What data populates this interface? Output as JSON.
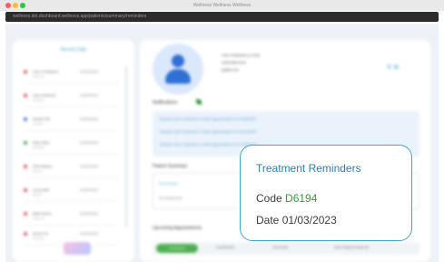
{
  "window": {
    "title": "Wellness Wellness Wellness",
    "url": "wellness.dot.dashboard.wellness.app/patients/summary/reminders",
    "traffic_colors": [
      "#ff5f57",
      "#febc2e",
      "#28c840"
    ]
  },
  "sidebar": {
    "title": "Recent Calls",
    "items": [
      {
        "name": "John Chambers",
        "sub": "Follow up",
        "date": "01/03/2023",
        "dot": "#e05757"
      },
      {
        "name": "Jane Ambrose",
        "sub": "Call back",
        "date": "01/03/2023",
        "dot": "#e05757"
      },
      {
        "name": "Robert Hill",
        "sub": "Checkup",
        "date": "01/03/2023",
        "dot": "#3a78d6"
      },
      {
        "name": "Mary Allen",
        "sub": "Reminder",
        "date": "01/03/2023",
        "dot": "#3aa65b"
      },
      {
        "name": "Paul Adams",
        "sub": "Missed",
        "date": "01/03/2023",
        "dot": "#e05757"
      },
      {
        "name": "Laura Bell",
        "sub": "Missed",
        "date": "01/03/2023",
        "dot": "#e05757"
      },
      {
        "name": "Mark Stone",
        "sub": "Follow up",
        "date": "01/03/2023",
        "dot": "#e05757"
      },
      {
        "name": "Anna Fox",
        "sub": "Call back",
        "date": "01/03/2023",
        "dot": "#e05757"
      }
    ]
  },
  "patient": {
    "name": "John Chambers (J-104)",
    "phone": "(415) 555-0101",
    "email": "jc@pt.com"
  },
  "notifications": {
    "title": "Notifications",
    "items": [
      "Remind John Chambers of their appointment on 01/03/2023",
      "Remind John Chambers of their appointment on 01/13/2023",
      "Remind John Chambers of their appointment on 01/23/2023"
    ]
  },
  "summary": {
    "title": "Patient Summary",
    "line1": "Root Recall",
    "line2": "No Recall Due"
  },
  "appointments": {
    "title": "Upcoming Appointments",
    "status": "Confirmed",
    "date": "01/03/2023",
    "time": "09:00 AM",
    "type": "New Patient Exam 60"
  },
  "reminder": {
    "title": "Treatment Reminders",
    "code_label": "Code",
    "code_value": "D6194",
    "date_label": "Date",
    "date_value": "01/03/2023",
    "accent": "#2c7fab",
    "code_color": "#2e9a3f"
  }
}
